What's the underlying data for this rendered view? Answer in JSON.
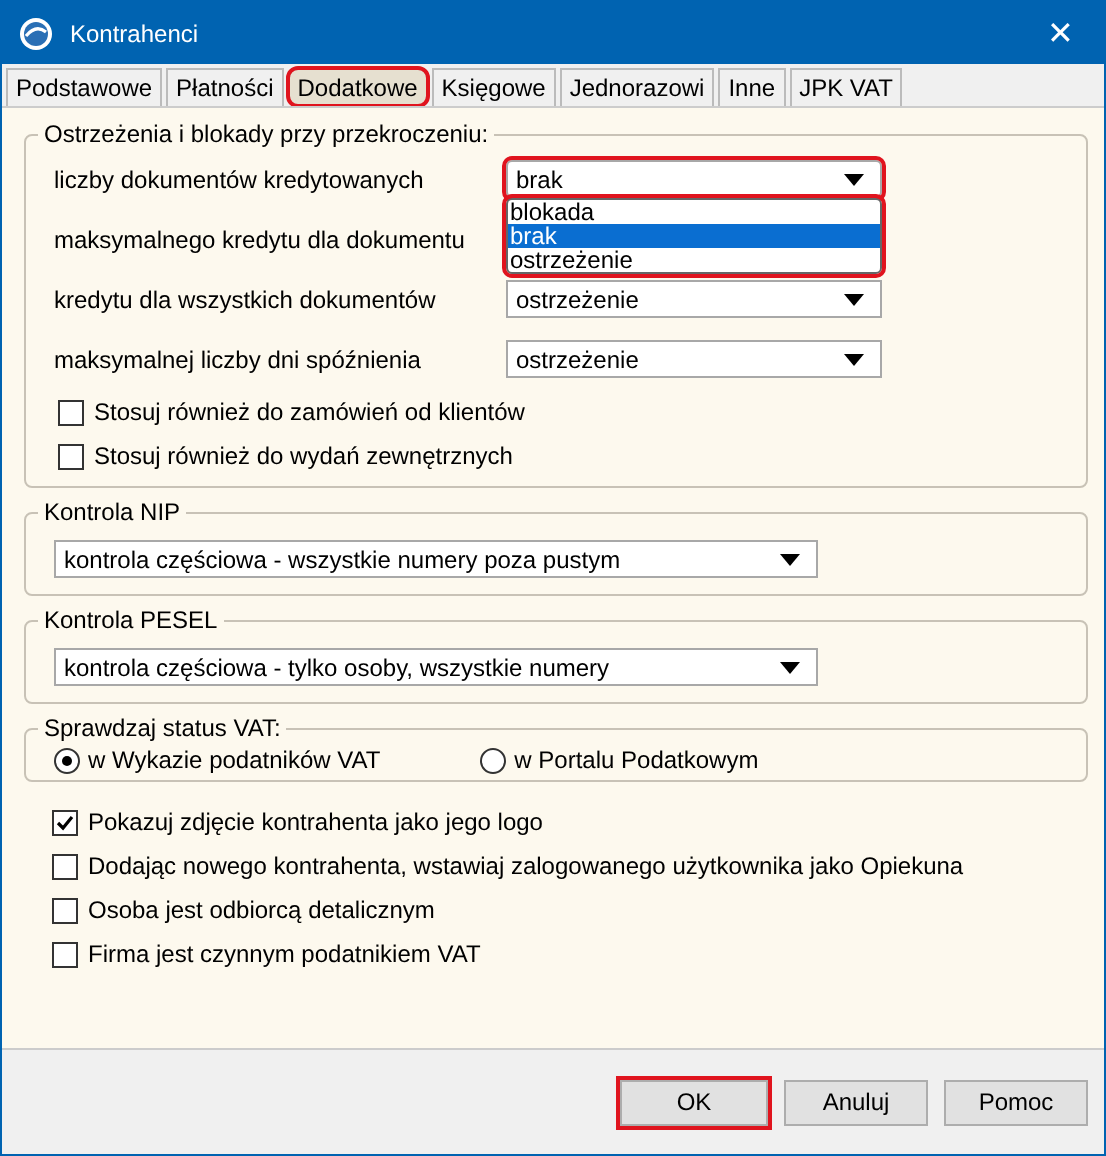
{
  "window": {
    "title": "Kontrahenci",
    "close": "✕"
  },
  "tabs": [
    {
      "label": "Podstawowe",
      "selected": false,
      "highlighted": false
    },
    {
      "label": "Płatności",
      "selected": false,
      "highlighted": false
    },
    {
      "label": "Dodatkowe",
      "selected": true,
      "highlighted": true
    },
    {
      "label": "Księgowe",
      "selected": false,
      "highlighted": false
    },
    {
      "label": "Jednorazowi",
      "selected": false,
      "highlighted": false
    },
    {
      "label": "Inne",
      "selected": false,
      "highlighted": false
    },
    {
      "label": "JPK VAT",
      "selected": false,
      "highlighted": false
    }
  ],
  "limits": {
    "title": "Ostrzeżenia i blokady przy przekroczeniu:",
    "rows": [
      {
        "label": "liczby dokumentów kredytowanych",
        "value": "brak",
        "open": true
      },
      {
        "label": "maksymalnego kredytu dla  dokumentu",
        "open": false
      },
      {
        "label": "kredytu dla wszystkich dokumentów",
        "value": "ostrzeżenie",
        "open": false
      },
      {
        "label": "maksymalnej liczby dni spóźnienia",
        "value": "ostrzeżenie",
        "open": false
      }
    ],
    "dropdown": {
      "highlighted": true,
      "options": [
        {
          "label": "blokada",
          "selected": false
        },
        {
          "label": "brak",
          "selected": true
        },
        {
          "label": "ostrzeżenie",
          "selected": false
        }
      ]
    },
    "checkboxes": [
      {
        "label": "Stosuj również do zamówień od klientów",
        "checked": false
      },
      {
        "label": "Stosuj również do wydań zewnętrznych",
        "checked": false
      }
    ]
  },
  "nip": {
    "title": "Kontrola NIP",
    "value": "kontrola częściowa - wszystkie numery poza pustym"
  },
  "pesel": {
    "title": "Kontrola PESEL",
    "value": "kontrola częściowa - tylko osoby, wszystkie numery"
  },
  "vat_status": {
    "title": "Sprawdzaj status VAT:",
    "options": [
      {
        "label": "w Wykazie podatników VAT",
        "selected": true
      },
      {
        "label": "w Portalu Podatkowym",
        "selected": false
      }
    ]
  },
  "options": [
    {
      "label": "Pokazuj zdjęcie kontrahenta jako jego logo",
      "checked": true
    },
    {
      "label": "Dodając nowego kontrahenta, wstawiaj zalogowanego użytkownika jako Opiekuna",
      "checked": false
    },
    {
      "label": "Osoba jest odbiorcą detalicznym",
      "checked": false
    },
    {
      "label": "Firma jest czynnym podatnikiem VAT",
      "checked": false
    }
  ],
  "buttons": [
    {
      "label": "OK",
      "highlighted": true
    },
    {
      "label": "Anuluj",
      "highlighted": false
    },
    {
      "label": "Pomoc",
      "highlighted": false
    }
  ]
}
